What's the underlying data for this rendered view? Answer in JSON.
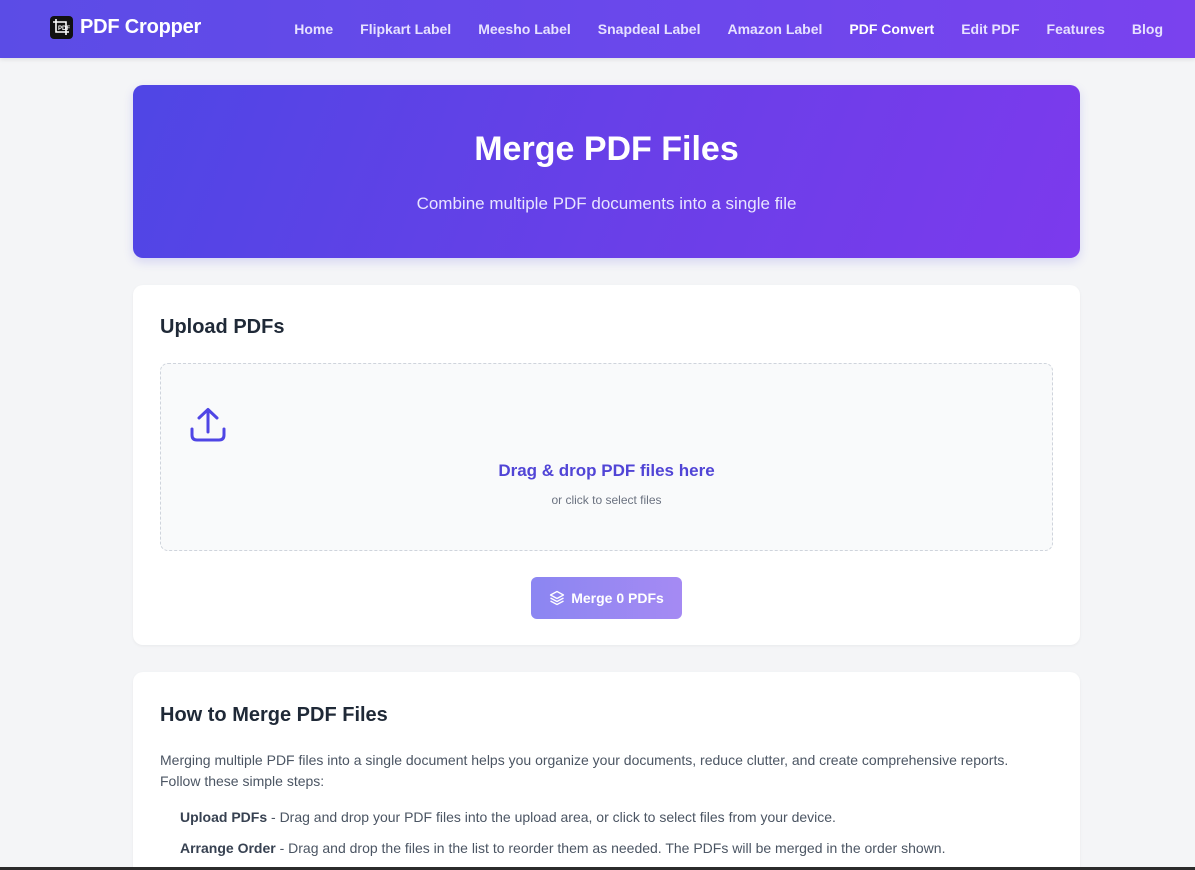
{
  "brand": {
    "name": "PDF Cropper",
    "logo_text": "PDF"
  },
  "nav": {
    "items": [
      {
        "label": "Home",
        "active": false
      },
      {
        "label": "Flipkart Label",
        "active": false
      },
      {
        "label": "Meesho Label",
        "active": false
      },
      {
        "label": "Snapdeal Label",
        "active": false
      },
      {
        "label": "Amazon Label",
        "active": false
      },
      {
        "label": "PDF Convert",
        "active": true
      },
      {
        "label": "Edit PDF",
        "active": false
      },
      {
        "label": "Features",
        "active": false
      },
      {
        "label": "Blog",
        "active": false
      }
    ]
  },
  "hero": {
    "title": "Merge PDF Files",
    "subtitle": "Combine multiple PDF documents into a single file"
  },
  "upload": {
    "title": "Upload PDFs",
    "drop_title": "Drag & drop PDF files here",
    "drop_subtitle": "or click to select files",
    "icon": "upload-icon",
    "merge_button_label": "Merge 0 PDFs",
    "merge_button_icon": "layers-icon"
  },
  "howto": {
    "title": "How to Merge PDF Files",
    "intro": "Merging multiple PDF files into a single document helps you organize your documents, reduce clutter, and create comprehensive reports. Follow these simple steps:",
    "steps": [
      {
        "label": "Upload PDFs",
        "text": " - Drag and drop your PDF files into the upload area, or click to select files from your device."
      },
      {
        "label": "Arrange Order",
        "text": " - Drag and drop the files in the list to reorder them as needed. The PDFs will be merged in the order shown."
      }
    ]
  },
  "colors": {
    "accent": "#5145d6",
    "header_gradient_start": "#5b4ce6",
    "header_gradient_end": "#7a42ee",
    "hero_gradient_start": "#4f46e5",
    "hero_gradient_end": "#7c3aed"
  }
}
